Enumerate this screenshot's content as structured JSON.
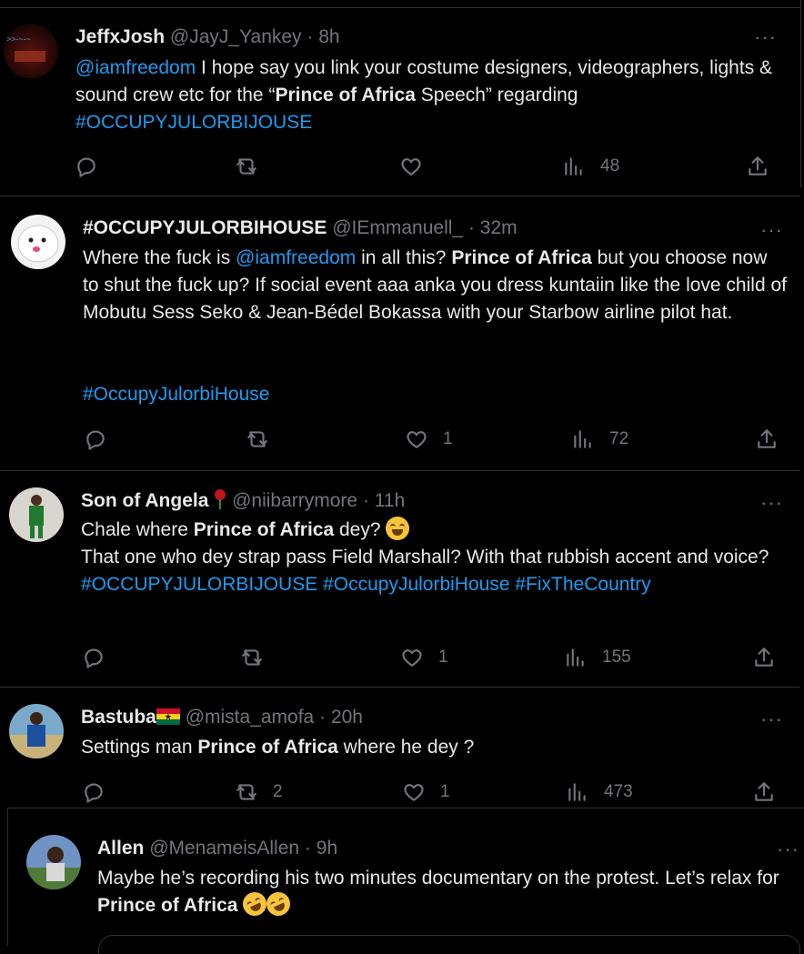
{
  "tweets": [
    {
      "name": "JeffxJosh",
      "handle": "@JayJ_Yankey",
      "dot": "·",
      "time": "8h",
      "more": "···",
      "mention": "@iamfreedom",
      "text1": " I hope say you link your costume designers, videographers, lights & sound crew etc for the “",
      "bold1": "Prince of Africa",
      "text2": " Speech” regarding ",
      "hashtag1": "#OCCUPYJULORBIJOUSE",
      "views": "48"
    },
    {
      "name": "#OCCUPYJULORBIHOUSE",
      "handle": "@IEmmanuell_",
      "dot": "·",
      "time": "32m",
      "more": "···",
      "text1": "Where the fuck is ",
      "mention": "@iamfreedom",
      "text2": " in all this? ",
      "bold1": "Prince of Africa",
      "text3": " but you choose now to shut the fuck up? If social event aaa anka you dress kuntaiin like the love child of Mobutu Sess Seko & Jean-Bédel Bokassa with your Starbow airline pilot hat.",
      "hashtag1": "#OccupyJulorbiHouse",
      "likes": "1",
      "views": "72"
    },
    {
      "name": "Son of Angela",
      "handle": "@niibarrymore",
      "dot": "·",
      "time": "11h",
      "more": "···",
      "text1": "Chale where ",
      "bold1": "Prince of Africa",
      "text2": " dey? ",
      "line2": "That one who dey strap pass Field Marshall? With that rubbish accent and voice?",
      "hashtag1": "#OCCUPYJULORBIJOUSE",
      "hashtag2": "#OccupyJulorbiHouse",
      "hashtag3": "#FixTheCountry",
      "likes": "1",
      "views": "155"
    },
    {
      "name": "Bastuba",
      "handle": "@mista_amofa",
      "dot": "·",
      "time": "20h",
      "more": "···",
      "text1": "Settings man ",
      "bold1": "Prince of Africa",
      "text2": " where he dey ?",
      "retweets": "2",
      "likes": "1",
      "views": "473"
    },
    {
      "name": "Allen",
      "handle": "@MenameisAllen",
      "dot": "·",
      "time": "9h",
      "more": "···",
      "text1": "Maybe he’s recording his two minutes  documentary on the protest. Let’s relax for ",
      "bold1": "Prince of Africa"
    }
  ],
  "icons": {
    "reply": "reply-icon",
    "retweet": "retweet-icon",
    "like": "like-icon",
    "views": "views-icon",
    "share": "share-icon"
  },
  "colors": {
    "background": "#000000",
    "text": "#e7e9ea",
    "muted": "#71767b",
    "link": "#1d9bf0",
    "divider": "#2f3336"
  }
}
